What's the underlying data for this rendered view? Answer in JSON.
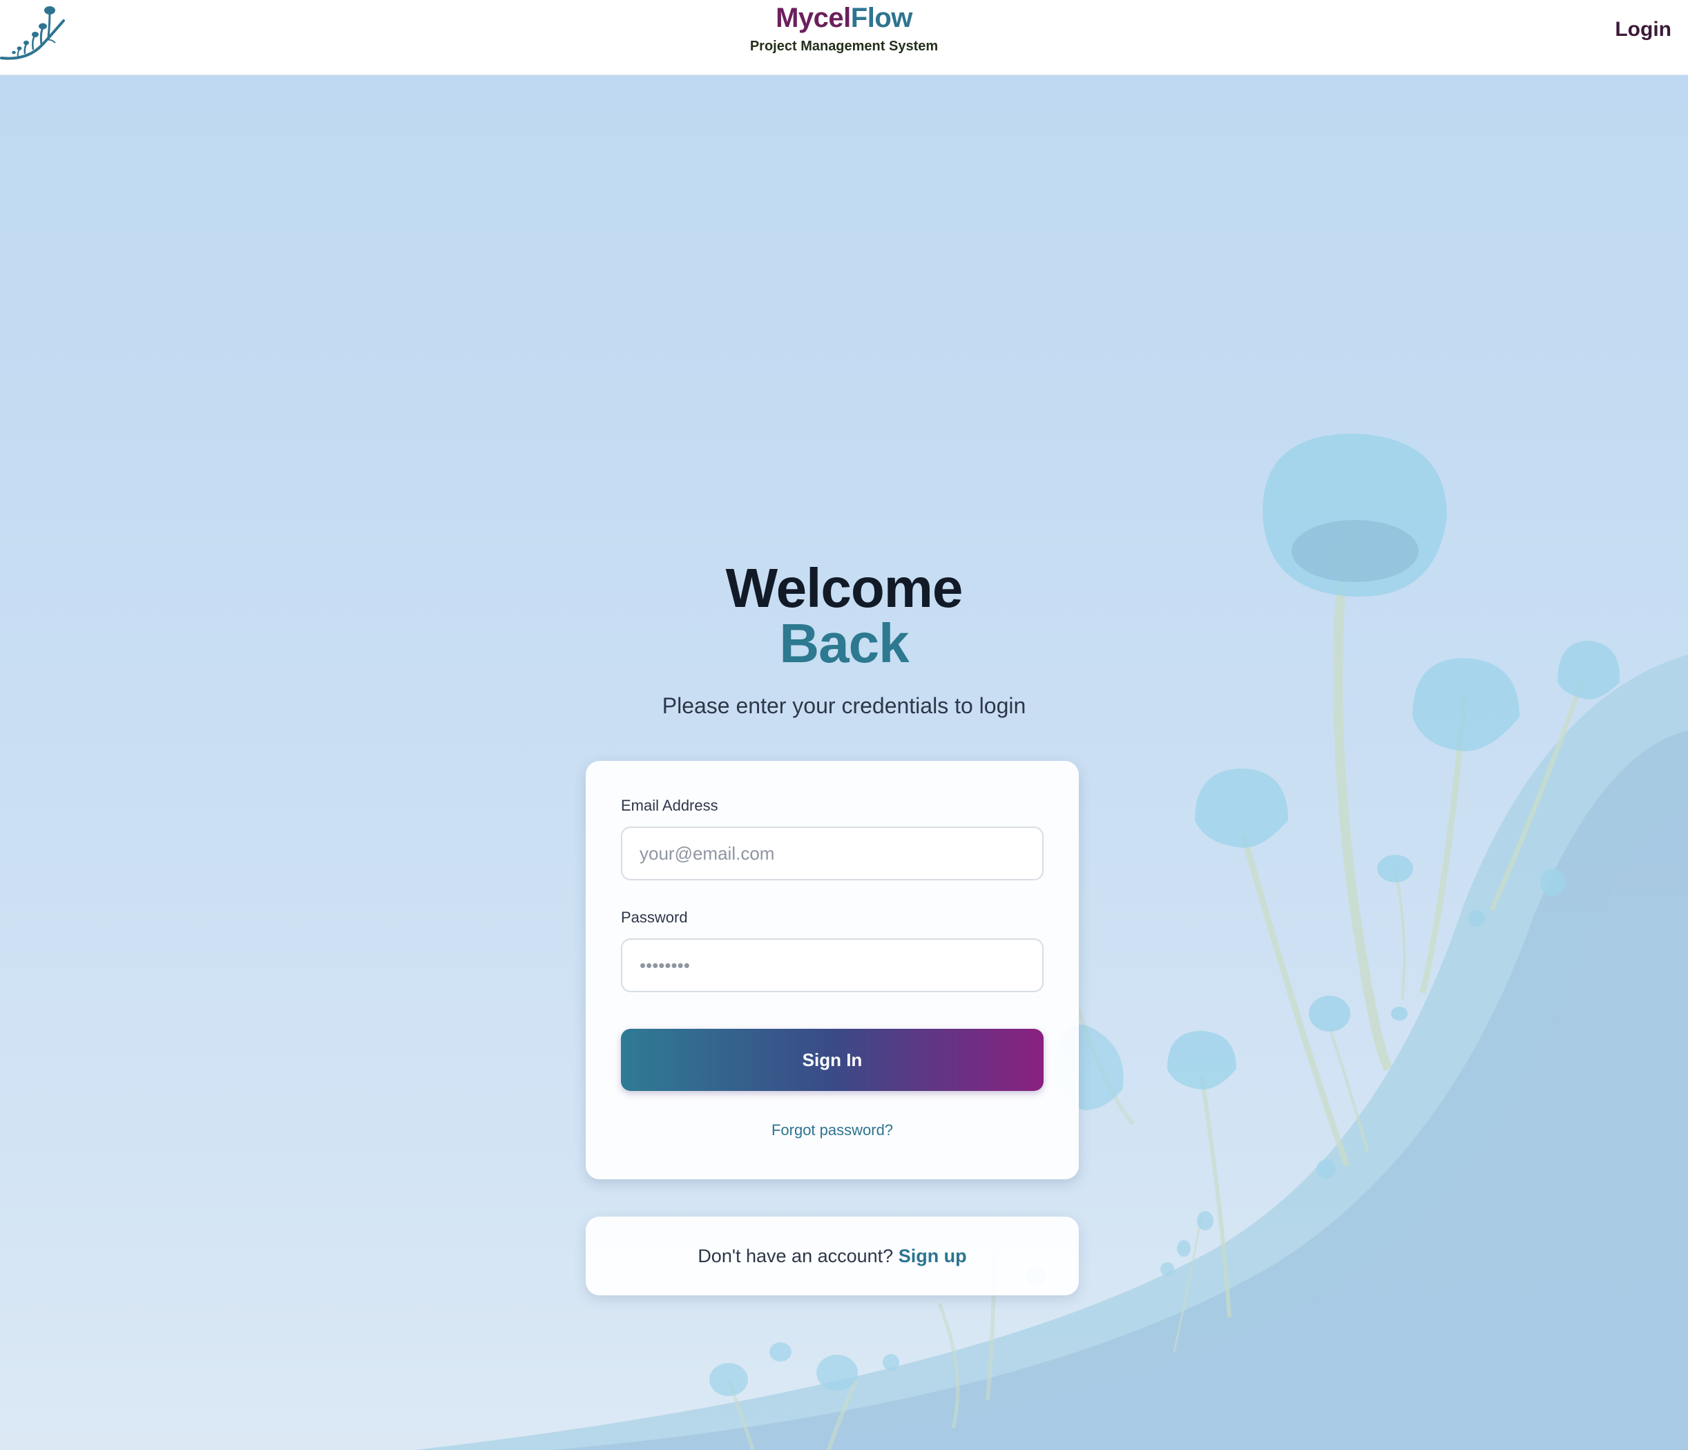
{
  "header": {
    "brand_part1": "Mycel",
    "brand_part2": "Flow",
    "tagline": "Project Management System",
    "login_label": "Login"
  },
  "main": {
    "title_line1": "Welcome",
    "title_line2": "Back",
    "subtitle": "Please enter your credentials to login"
  },
  "form": {
    "email_label": "Email Address",
    "email_placeholder": "your@email.com",
    "email_value": "",
    "password_label": "Password",
    "password_placeholder": "••••••••",
    "password_value": "",
    "submit_label": "Sign In",
    "forgot_label": "Forgot password?"
  },
  "signup_prompt": {
    "text": "Don't have an account?",
    "link_label": "Sign up"
  },
  "colors": {
    "brand_purple": "#6b1f5c",
    "brand_teal": "#2e7490",
    "accent_teal": "#2c7990",
    "button_gradient_start": "#2f7b94",
    "button_gradient_end": "#8a2080",
    "background": "#c3dbf1"
  },
  "icons": {
    "logo": "mushroom-logo-icon"
  }
}
